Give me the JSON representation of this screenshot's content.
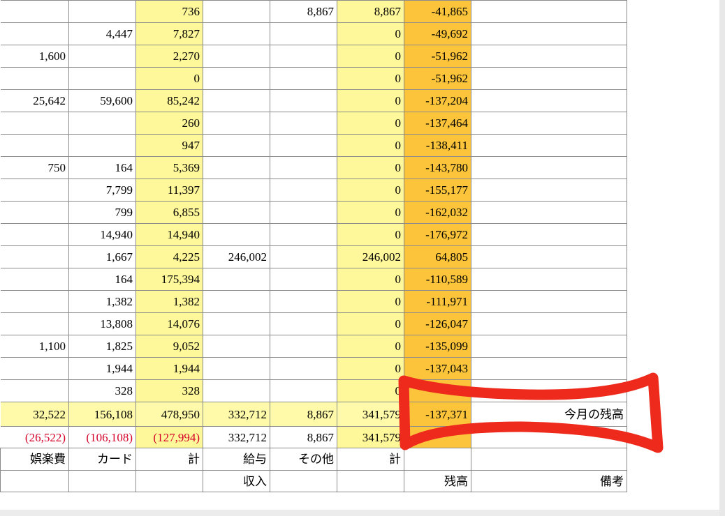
{
  "rows": [
    [
      "",
      "",
      "736",
      "",
      "8,867",
      "8,867",
      "-41,865",
      ""
    ],
    [
      "",
      "4,447",
      "7,827",
      "",
      "",
      "0",
      "-49,692",
      ""
    ],
    [
      "1,600",
      "",
      "2,270",
      "",
      "",
      "0",
      "-51,962",
      ""
    ],
    [
      "",
      "",
      "0",
      "",
      "",
      "0",
      "-51,962",
      ""
    ],
    [
      "25,642",
      "59,600",
      "85,242",
      "",
      "",
      "0",
      "-137,204",
      ""
    ],
    [
      "",
      "",
      "260",
      "",
      "",
      "0",
      "-137,464",
      ""
    ],
    [
      "",
      "",
      "947",
      "",
      "",
      "0",
      "-138,411",
      ""
    ],
    [
      "750",
      "164",
      "5,369",
      "",
      "",
      "0",
      "-143,780",
      ""
    ],
    [
      "",
      "7,799",
      "11,397",
      "",
      "",
      "0",
      "-155,177",
      ""
    ],
    [
      "",
      "799",
      "6,855",
      "",
      "",
      "0",
      "-162,032",
      ""
    ],
    [
      "",
      "14,940",
      "14,940",
      "",
      "",
      "0",
      "-176,972",
      ""
    ],
    [
      "",
      "1,667",
      "4,225",
      "246,002",
      "",
      "246,002",
      "64,805",
      ""
    ],
    [
      "",
      "164",
      "175,394",
      "",
      "",
      "0",
      "-110,589",
      ""
    ],
    [
      "",
      "1,382",
      "1,382",
      "",
      "",
      "0",
      "-111,971",
      ""
    ],
    [
      "",
      "13,808",
      "14,076",
      "",
      "",
      "0",
      "-126,047",
      ""
    ],
    [
      "1,100",
      "1,825",
      "9,052",
      "",
      "",
      "0",
      "-135,099",
      ""
    ],
    [
      "",
      "1,944",
      "1,944",
      "",
      "",
      "0",
      "-137,043",
      ""
    ],
    [
      "",
      "328",
      "328",
      "",
      "",
      "0",
      "",
      ""
    ]
  ],
  "total_row": [
    "32,522",
    "156,108",
    "478,950",
    "332,712",
    "8,867",
    "341,579",
    "-137,371",
    "今月の残高"
  ],
  "diff_row": [
    "(26,522)",
    "(106,108)",
    "(127,994)",
    "332,712",
    "8,867",
    "341,579",
    "",
    ""
  ],
  "header_row1": [
    "娯楽費",
    "カード",
    "計",
    "給与",
    "その他",
    "計",
    "",
    ""
  ],
  "header_row2": [
    "",
    "",
    "",
    "収入",
    "",
    "",
    "残高",
    "備考"
  ],
  "colors": {
    "expense_total_col": "#fef89a",
    "income_total_col": "#fef89a",
    "balance_col": "#fbc43a",
    "diff_row": "#f79cc8",
    "negative_text": "#d4002a",
    "header_entertainment": "#c59bf2",
    "header_card": "#fb9d46",
    "header_bottom": "#f9c89d",
    "annotation": "#ee2a1c"
  }
}
